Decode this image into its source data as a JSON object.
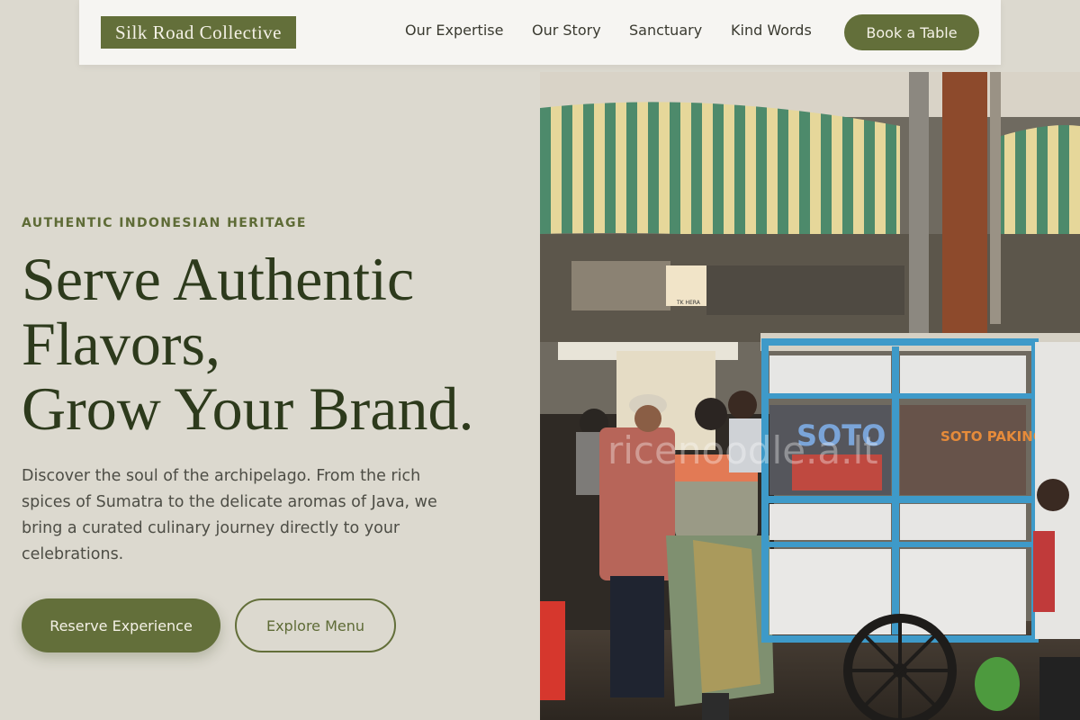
{
  "nav": {
    "logo": "Silk Road Collective",
    "links": [
      "Our Expertise",
      "Our Story",
      "Sanctuary",
      "Kind Words"
    ],
    "cta": "Book a Table"
  },
  "hero": {
    "eyebrow": "AUTHENTIC INDONESIAN HERITAGE",
    "headline": [
      "Serve Authentic",
      "Flavors,",
      "Grow Your Brand."
    ],
    "lead": "Discover the soul of the archipelago. From the rich spices of Sumatra to the delicate aromas of Java, we bring a curated culinary journey directly to your celebrations.",
    "primary_button": "Reserve Experience",
    "secondary_button": "Explore Menu"
  },
  "image": {
    "cart_sign_left": "SOTO",
    "cart_sign_right": "SOTO PAKING",
    "watermark": "ricenoodle.a.lt",
    "stall_sign": "TK HERA"
  },
  "colors": {
    "accent": "#636f3a",
    "background": "#dcd9cf",
    "heading": "#2d3a1c"
  }
}
